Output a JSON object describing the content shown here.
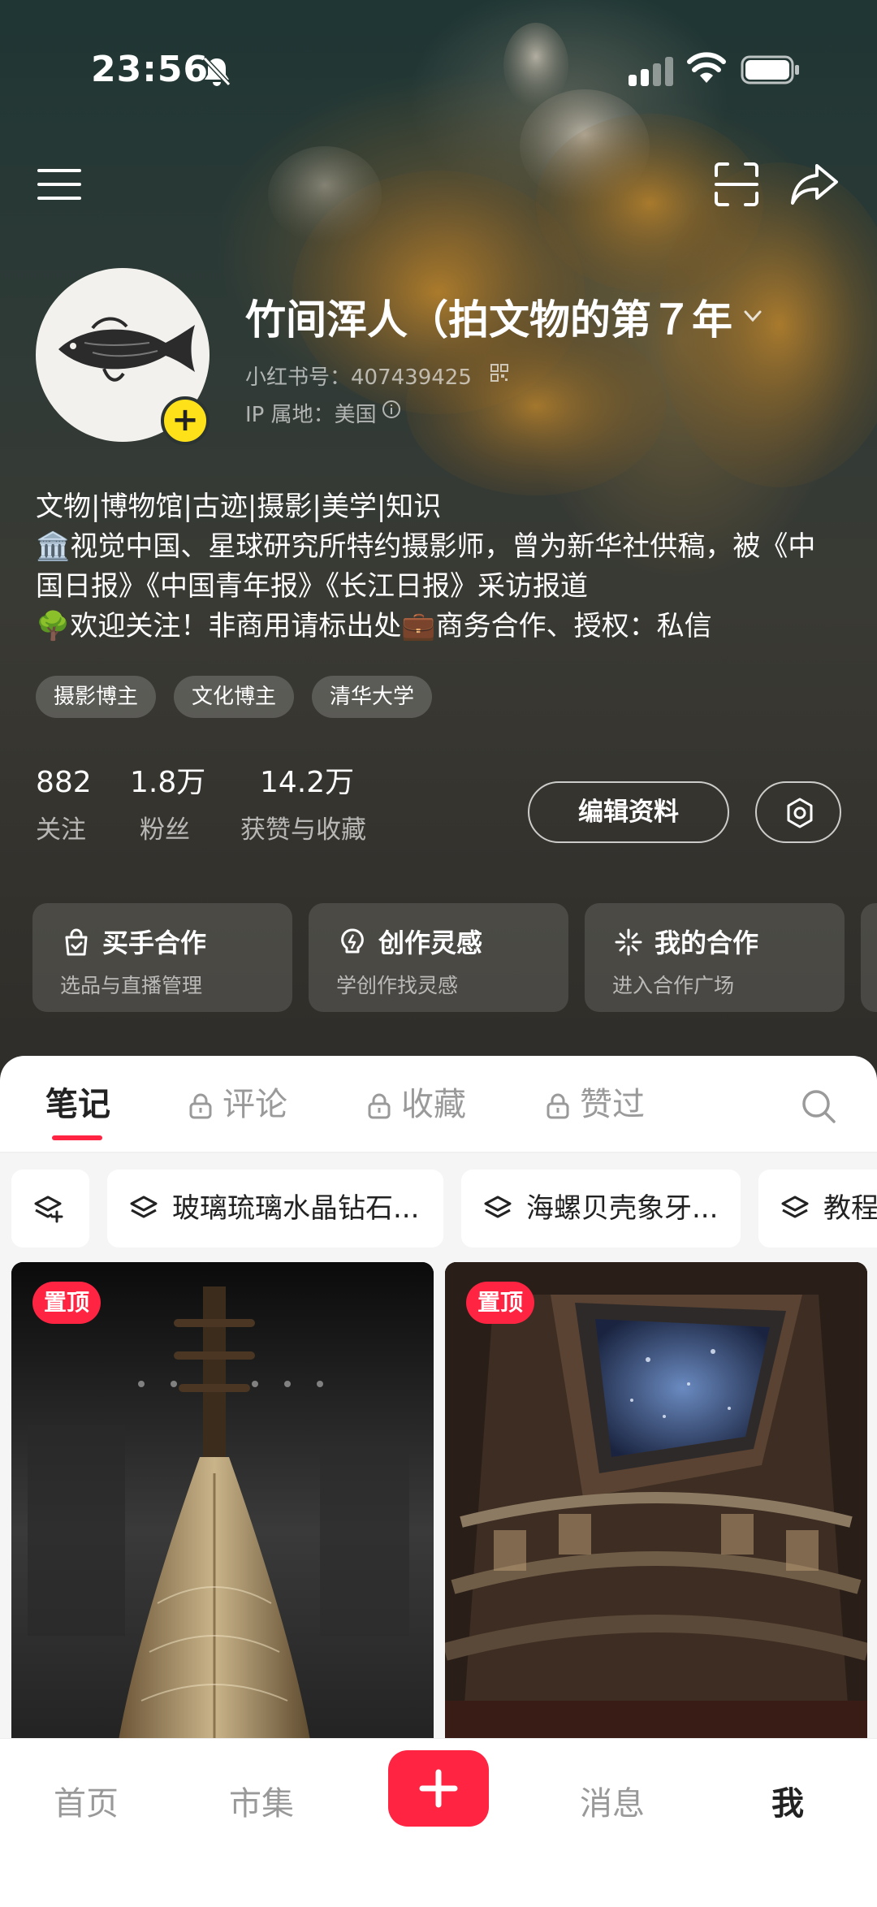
{
  "status_bar": {
    "time": "23:56"
  },
  "profile": {
    "nickname": "竹间浑人（拍文物的第７年",
    "red_id": "小红书号：407439425",
    "ip_location": "IP 属地：美国",
    "bio": [
      "文物|博物馆|古迹|摄影|美学|知识",
      "🏛️视觉中国、星球研究所特约摄影师，曾为新华社供稿，被《中",
      "国日报》《中国青年报》《长江日报》采访报道",
      "🌳欢迎关注！非商用请标出处💼商务合作、授权：私信"
    ],
    "tags": [
      "摄影博主",
      "文化博主",
      "清华大学"
    ]
  },
  "stats": {
    "following": {
      "value": "882",
      "label": "关注"
    },
    "followers": {
      "value": "1.8万",
      "label": "粉丝"
    },
    "likes": {
      "value": "14.2万",
      "label": "获赞与收藏"
    }
  },
  "actions": {
    "edit_profile": "编辑资料"
  },
  "cards": [
    {
      "title": "买手合作",
      "subtitle": "选品与直播管理",
      "icon": "bag-icon"
    },
    {
      "title": "创作灵感",
      "subtitle": "学创作找灵感",
      "icon": "bulb-icon"
    },
    {
      "title": "我的合作",
      "subtitle": "进入合作广场",
      "icon": "sparkle-icon"
    }
  ],
  "tabs": [
    {
      "label": "笔记",
      "active": true,
      "locked": false
    },
    {
      "label": "评论",
      "active": false,
      "locked": true
    },
    {
      "label": "收藏",
      "active": false,
      "locked": true
    },
    {
      "label": "赞过",
      "active": false,
      "locked": true
    }
  ],
  "collections": [
    "玻璃琉璃水晶钻石...",
    "海螺贝壳象牙...",
    "教程"
  ],
  "notes": [
    {
      "badge": "置顶",
      "image": "pipa-lute-photo"
    },
    {
      "badge": "置顶",
      "image": "tomb-ceiling-photo"
    }
  ],
  "bottom_nav": [
    "首页",
    "市集",
    "消息",
    "我"
  ],
  "colors": {
    "brand_red": "#ff2442",
    "avatar_add": "#ffe11a"
  }
}
